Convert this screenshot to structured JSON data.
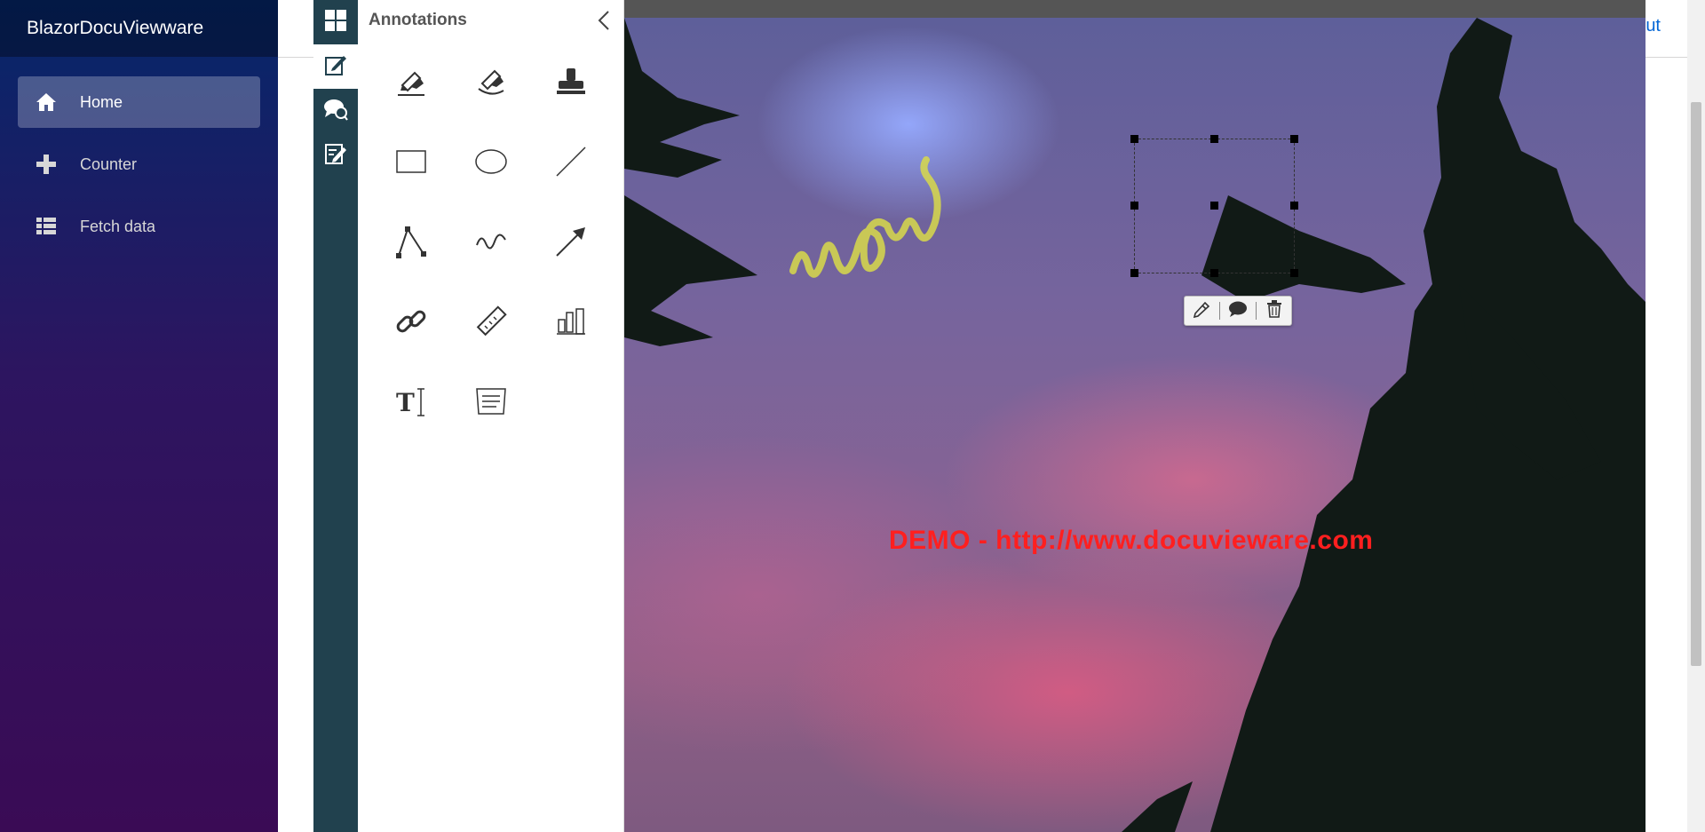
{
  "app": {
    "brand": "BlazorDocuViewware"
  },
  "nav": {
    "items": [
      {
        "label": "Home",
        "icon": "home-icon",
        "active": true
      },
      {
        "label": "Counter",
        "icon": "plus-icon",
        "active": false
      },
      {
        "label": "Fetch data",
        "icon": "list-icon",
        "active": false
      }
    ]
  },
  "topbar": {
    "link": "ut"
  },
  "viewer": {
    "panel_title": "Annotations",
    "watermark": "DEMO - http://www.docuvieware.com",
    "side_tabs": [
      "thumbnails-icon",
      "annotations-icon",
      "comments-icon",
      "forms-icon"
    ],
    "tools": [
      "highlighter-icon",
      "eraser-highlighter-icon",
      "stamp-icon",
      "rectangle-icon",
      "ellipse-icon",
      "line-icon",
      "polyline-icon",
      "freehand-icon",
      "arrow-icon",
      "link-icon",
      "ruler-icon",
      "area-measure-icon",
      "text-icon",
      "sticky-note-icon"
    ],
    "annotation_toolbar": [
      "edit-icon",
      "comment-icon",
      "delete-icon"
    ],
    "selected_annotation_text": "wow",
    "colors": {
      "strip": "#21414e",
      "watermark": "#ff1f1f",
      "ink": "#d8d94a"
    }
  }
}
